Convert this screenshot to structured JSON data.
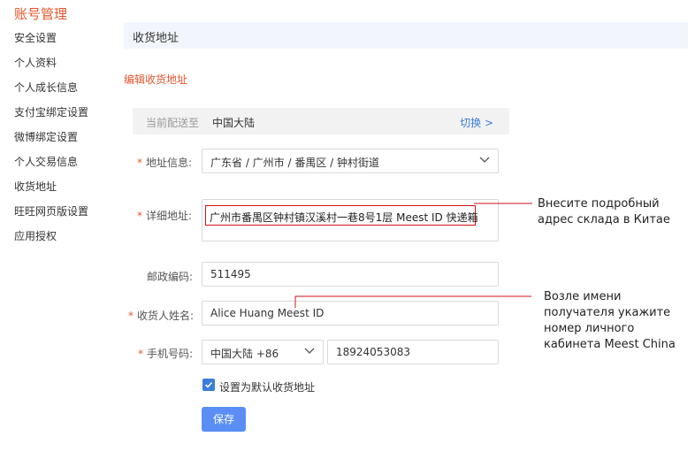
{
  "sidebar": {
    "title": "账号管理",
    "items": [
      {
        "label": "安全设置"
      },
      {
        "label": "个人资料"
      },
      {
        "label": "个人成长信息"
      },
      {
        "label": "支付宝绑定设置"
      },
      {
        "label": "微博绑定设置"
      },
      {
        "label": "个人交易信息"
      },
      {
        "label": "收货地址"
      },
      {
        "label": "旺旺网页版设置"
      },
      {
        "label": "应用授权"
      }
    ]
  },
  "main": {
    "section_title": "收货地址",
    "edit_title": "编辑收货地址",
    "current_region": {
      "label": "当前配送至",
      "value": "中国大陆",
      "switch": "切换 >"
    },
    "form": {
      "region": {
        "label": "地址信息:",
        "value": "广东省 / 广州市 / 番禺区 / 钟村街道"
      },
      "detail": {
        "label": "详细地址:",
        "value": "广州市番禺区钟村镇汉溪村一巷8号1层 Meest ID 快递箱"
      },
      "postcode": {
        "label": "邮政编码:",
        "value": "511495"
      },
      "recipient": {
        "label": "收货人姓名:",
        "value": "Alice Huang Meest ID"
      },
      "phone": {
        "label": "手机号码:",
        "country": "中国大陆 +86",
        "number": "18924053083"
      },
      "default_checkbox": {
        "label": "设置为默认收货地址",
        "checked": true
      },
      "save_label": "保存"
    }
  },
  "annotations": {
    "note1": [
      "Внесите подробный",
      "адрес склада в Китае"
    ],
    "note2": [
      "Возле имени",
      "получателя укажите",
      "номер личного",
      "кабинета Meest China"
    ]
  },
  "colors": {
    "accent": "#e4572e",
    "link": "#3b7dd8",
    "button": "#5b8ef5",
    "highlight": "#d0111b"
  }
}
